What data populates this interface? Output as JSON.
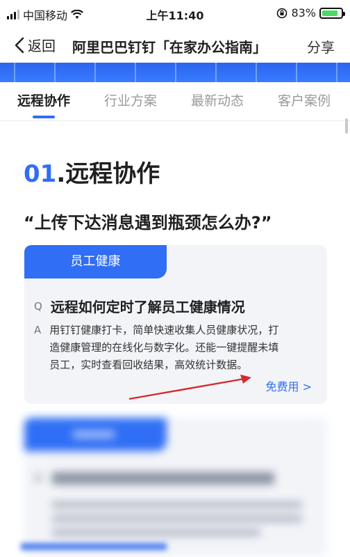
{
  "status_bar": {
    "carrier": "中国移动",
    "time": "上午11:40",
    "battery_percent": "83%",
    "battery_level": 0.83,
    "icons": [
      "signal-icon",
      "wifi-icon",
      "orientation-lock-icon",
      "battery-icon"
    ]
  },
  "nav": {
    "back_label": "返回",
    "title": "阿里巴巴钉钉「在家办公指南」",
    "share_label": "分享"
  },
  "tabs": [
    {
      "label": "远程协作",
      "active": true
    },
    {
      "label": "行业方案",
      "active": false
    },
    {
      "label": "最新动态",
      "active": false
    },
    {
      "label": "客户案例",
      "active": false
    }
  ],
  "section": {
    "number": "01",
    "title": ".远程协作",
    "question": "“上传下达消息遇到瓶颈怎么办?”"
  },
  "card": {
    "badge": "员工健康",
    "q_mark": "Q",
    "q_text": "远程如何定时了解员工健康情况",
    "a_mark": "A",
    "a_text": "用钉钉健康打卡，简单快速收集人员健康状况，打造健康管理的在线化与数字化。还能一键提醒未填员工，实时查看回收结果，高效统计数据。",
    "link": "免费用 >"
  },
  "colors": {
    "accent": "#2f6ef5",
    "annotation_arrow": "#d42a2a",
    "card_bg": "#f2f4f8"
  }
}
